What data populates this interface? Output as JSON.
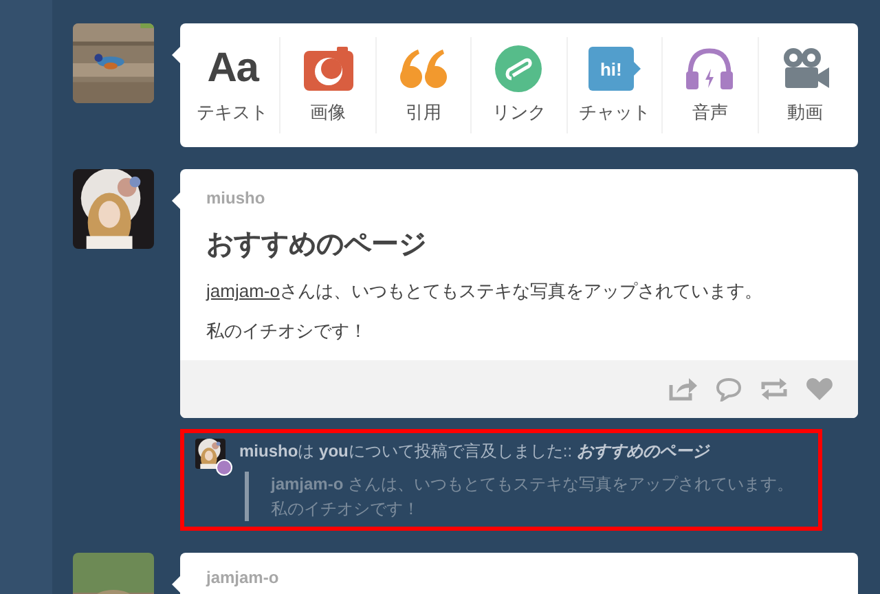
{
  "composer": {
    "items": [
      {
        "kind": "text",
        "glyph": "Aa",
        "label": "テキスト"
      },
      {
        "label": "画像"
      },
      {
        "kind": "quote",
        "label": "引用"
      },
      {
        "kind": "link",
        "label": "リンク"
      },
      {
        "kind": "chat",
        "glyph": "hi!",
        "label": "チャット"
      },
      {
        "kind": "audio",
        "label": "音声"
      },
      {
        "kind": "video",
        "label": "動画"
      }
    ]
  },
  "post": {
    "author": "miusho",
    "title": "おすすめのページ",
    "paragraphs": [
      {
        "link": "jamjam-o",
        "text": "さんは、いつもとてもステキな写真をアップされています。"
      },
      {
        "text": "私のイチオシです！"
      }
    ],
    "actions": [
      {
        "kind": "share"
      },
      {
        "kind": "reply"
      },
      {
        "kind": "reblog"
      },
      {
        "kind": "like"
      }
    ]
  },
  "mention": {
    "text": "**miusho**は **you**について投稿で言及しました:: *おすすめのページ*",
    "quote": "**jamjam-o** さんは、いつもとてもステキな写真をアップされています。私のイチオシです！"
  },
  "next_post": {
    "author": "jamjam-o"
  }
}
